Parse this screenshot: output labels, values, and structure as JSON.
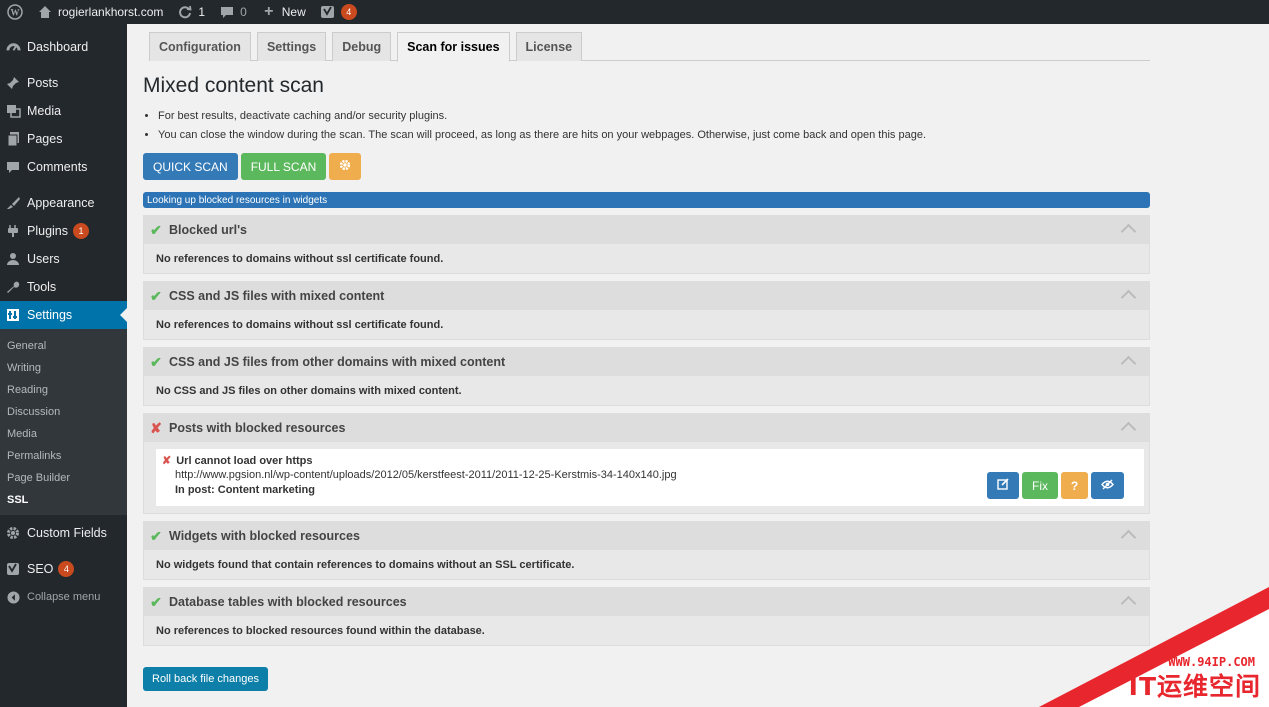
{
  "adminbar": {
    "site_name": "rogierlankhorst.com",
    "updates_count": "1",
    "comments_count": "0",
    "new_label": "New",
    "seo_badge": "4"
  },
  "sidebar": {
    "items": [
      {
        "label": "Dashboard",
        "icon": "dashboard-icon"
      },
      {
        "label": "Posts",
        "icon": "pin-icon"
      },
      {
        "label": "Media",
        "icon": "media-icon"
      },
      {
        "label": "Pages",
        "icon": "pages-icon"
      },
      {
        "label": "Comments",
        "icon": "comment-icon"
      },
      {
        "label": "Appearance",
        "icon": "brush-icon"
      },
      {
        "label": "Plugins",
        "icon": "plugin-icon",
        "badge": "1"
      },
      {
        "label": "Users",
        "icon": "users-icon"
      },
      {
        "label": "Tools",
        "icon": "wrench-icon"
      },
      {
        "label": "Settings",
        "icon": "settings-icon"
      }
    ],
    "submenu": [
      "General",
      "Writing",
      "Reading",
      "Discussion",
      "Media",
      "Permalinks",
      "Page Builder",
      "SSL"
    ],
    "after": [
      {
        "label": "Custom Fields",
        "icon": "gear-icon"
      },
      {
        "label": "SEO",
        "icon": "seo-icon",
        "badge": "4"
      }
    ],
    "collapse_label": "Collapse menu"
  },
  "tabs": [
    "Configuration",
    "Settings",
    "Debug",
    "Scan for issues",
    "License"
  ],
  "page_title": "Mixed content scan",
  "notes": [
    "For best results, deactivate caching and/or security plugins.",
    "You can close the window during the scan. The scan will proceed, as long as there are hits on your webpages. Otherwise, just come back and open this page."
  ],
  "buttons": {
    "quick_scan": "QUICK SCAN",
    "full_scan": "FULL SCAN",
    "settings_icon": "gear-icon"
  },
  "progress": {
    "label": "Looking up blocked resources in widgets",
    "value": 1.0
  },
  "panels": [
    {
      "title": "Blocked url's",
      "status": "ok",
      "message": "No references to domains without ssl certificate found."
    },
    {
      "title": "CSS and JS files with mixed content",
      "status": "ok",
      "message": "No references to domains without ssl certificate found."
    },
    {
      "title": "CSS and JS files from other domains with mixed content",
      "status": "ok",
      "message": "No CSS and JS files on other domains with mixed content."
    },
    {
      "title": "Posts with blocked resources",
      "status": "error"
    },
    {
      "title": "Widgets with blocked resources",
      "status": "ok",
      "message": "No widgets found that contain references to domains without an SSL certificate."
    },
    {
      "title": "Database tables with blocked resources",
      "status": "ok",
      "message": "No references to blocked resources found within the database."
    }
  ],
  "issue": {
    "title": "Url cannot load over https",
    "url": "http://www.pgsion.nl/wp-content/uploads/2012/05/kerstfeest-2011/2011-12-25-Kerstmis-34-140x140.jpg",
    "post": "In post: Content marketing",
    "fix_label": "Fix",
    "help_label": "?"
  },
  "rollback_label": "Roll back file changes",
  "watermark": {
    "url": "WWW.94IP.COM",
    "brand": "IT运维空间"
  },
  "colors": {
    "primary": "#337ab7",
    "success": "#5cb85c",
    "warning": "#f0ad4e",
    "danger": "#d9534f",
    "admin_blue": "#0073aa"
  }
}
